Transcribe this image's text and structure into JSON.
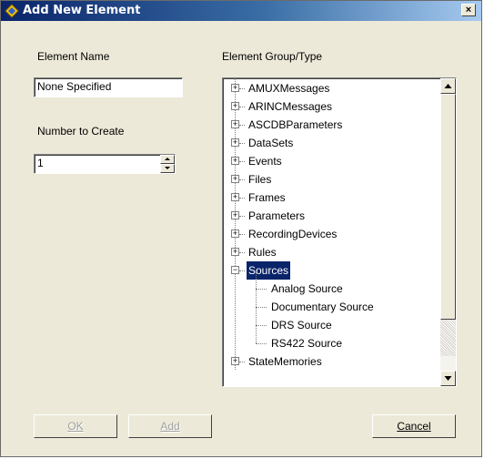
{
  "window": {
    "title": "Add New Element",
    "close_label": "×"
  },
  "form": {
    "element_name_label": "Element Name",
    "element_name_value": "None Specified",
    "number_to_create_label": "Number to Create",
    "number_to_create_value": "1",
    "group_type_label": "Element Group/Type"
  },
  "tree": {
    "nodes": [
      {
        "label": "AMUXMessages",
        "expander": "+"
      },
      {
        "label": "ARINCMessages",
        "expander": "+"
      },
      {
        "label": "ASCDBParameters",
        "expander": "+"
      },
      {
        "label": "DataSets",
        "expander": "+"
      },
      {
        "label": "Events",
        "expander": "+"
      },
      {
        "label": "Files",
        "expander": "+"
      },
      {
        "label": "Frames",
        "expander": "+"
      },
      {
        "label": "Parameters",
        "expander": "+"
      },
      {
        "label": "RecordingDevices",
        "expander": "+"
      },
      {
        "label": "Rules",
        "expander": "+"
      },
      {
        "label": "Sources",
        "expander": "−",
        "selected": true
      },
      {
        "label": "StateMemories",
        "expander": "+"
      }
    ],
    "children": [
      {
        "label": "Analog Source"
      },
      {
        "label": "Documentary Source"
      },
      {
        "label": "DRS Source"
      },
      {
        "label": "RS422 Source"
      }
    ],
    "scroll_up_icon": "triangle-up-icon",
    "scroll_down_icon": "triangle-down-icon"
  },
  "buttons": {
    "ok_label": "OK",
    "add_label": "Add",
    "cancel_label": "Cancel"
  },
  "colors": {
    "title_gradient_start": "#0a246a",
    "selection": "#0a246a",
    "face": "#ece9d8"
  }
}
